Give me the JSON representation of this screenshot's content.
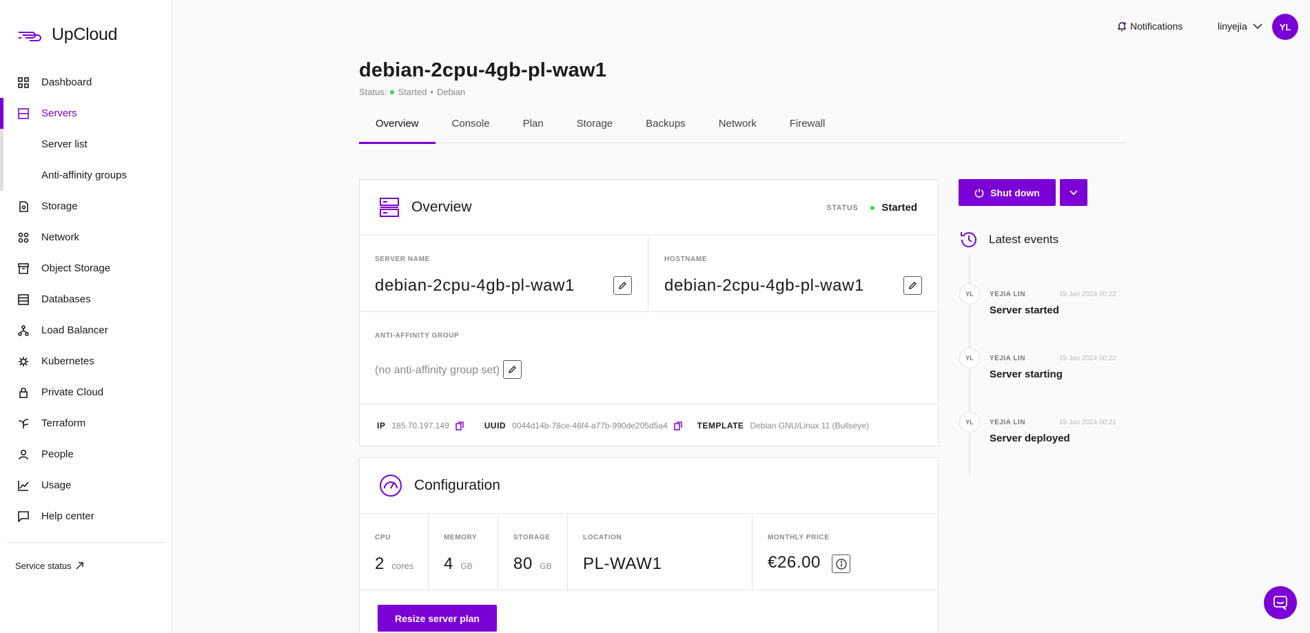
{
  "brand": {
    "name": "UpCloud"
  },
  "sidebar": {
    "items": [
      {
        "label": "Dashboard",
        "icon": "dashboard-icon"
      },
      {
        "label": "Servers",
        "icon": "servers-icon",
        "active": true
      },
      {
        "label": "Storage",
        "icon": "storage-icon"
      },
      {
        "label": "Network",
        "icon": "network-icon"
      },
      {
        "label": "Object Storage",
        "icon": "object-storage-icon"
      },
      {
        "label": "Databases",
        "icon": "databases-icon"
      },
      {
        "label": "Load Balancer",
        "icon": "load-balancer-icon"
      },
      {
        "label": "Kubernetes",
        "icon": "kubernetes-icon"
      },
      {
        "label": "Private Cloud",
        "icon": "lock-icon"
      },
      {
        "label": "Terraform",
        "icon": "terraform-icon"
      },
      {
        "label": "People",
        "icon": "person-icon"
      },
      {
        "label": "Usage",
        "icon": "chart-icon"
      },
      {
        "label": "Help center",
        "icon": "chat-icon"
      }
    ],
    "sub_items": [
      {
        "label": "Server list"
      },
      {
        "label": "Anti-affinity groups"
      }
    ],
    "service_status": "Service status"
  },
  "topbar": {
    "notifications": "Notifications",
    "username": "linyejia",
    "avatar_initials": "YL"
  },
  "header": {
    "title": "debian-2cpu-4gb-pl-waw1",
    "status_prefix": "Status:",
    "status": "Started",
    "separator": "•",
    "os": "Debian"
  },
  "tabs": [
    "Overview",
    "Console",
    "Plan",
    "Storage",
    "Backups",
    "Network",
    "Firewall"
  ],
  "overview": {
    "title": "Overview",
    "status_label": "STATUS",
    "status_value": "Started",
    "server_name_label": "SERVER NAME",
    "server_name": "debian-2cpu-4gb-pl-waw1",
    "hostname_label": "HOSTNAME",
    "hostname": "debian-2cpu-4gb-pl-waw1",
    "anti_affinity_label": "ANTI-AFFINITY GROUP",
    "anti_affinity_value": "(no anti-affinity group set)",
    "ip_label": "IP",
    "ip": "185.70.197.149",
    "uuid_label": "UUID",
    "uuid": "0044d14b-78ce-46f4-a77b-990de205d5a4",
    "template_label": "TEMPLATE",
    "template": "Debian GNU/Linux 11 (Bullseye)"
  },
  "configuration": {
    "title": "Configuration",
    "cpu_label": "CPU",
    "cpu_value": "2",
    "cpu_unit": "cores",
    "memory_label": "MEMORY",
    "memory_value": "4",
    "memory_unit": "GB",
    "storage_label": "STORAGE",
    "storage_value": "80",
    "storage_unit": "GB",
    "location_label": "LOCATION",
    "location_value": "PL-WAW1",
    "price_label": "MONTHLY PRICE",
    "price_value": "€26.00",
    "resize_button": "Resize server plan"
  },
  "actions": {
    "shutdown": "Shut down"
  },
  "events": {
    "title": "Latest events",
    "items": [
      {
        "initials": "YL",
        "user": "YEJIA LIN",
        "date": "19 Jan 2024 00:22",
        "title": "Server started"
      },
      {
        "initials": "YL",
        "user": "YEJIA LIN",
        "date": "19 Jan 2024 00:22",
        "title": "Server starting"
      },
      {
        "initials": "YL",
        "user": "YEJIA LIN",
        "date": "19 Jan 2024 00:21",
        "title": "Server deployed"
      }
    ]
  },
  "colors": {
    "accent": "#7b00d6",
    "status_green": "#3ad35a"
  }
}
